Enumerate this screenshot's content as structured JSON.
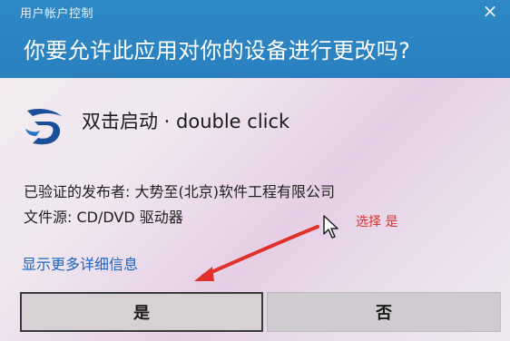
{
  "header": {
    "title": "用户帐户控制",
    "question": "你要允许此应用对你的设备进行更改吗?",
    "close_label": "×"
  },
  "app": {
    "name": "双击启动 · double click",
    "icon": "app-logo-icon"
  },
  "info": {
    "publisher": "已验证的发布者: 大势至(北京)软件工程有限公司",
    "source": "文件源: CD/DVD 驱动器"
  },
  "details_link": "显示更多详细信息",
  "buttons": {
    "yes": "是",
    "no": "否"
  },
  "annotation": {
    "text": "选择 是",
    "color": "#e0312b"
  },
  "colors": {
    "header": "#2e89c5",
    "link": "#1a64c4"
  }
}
